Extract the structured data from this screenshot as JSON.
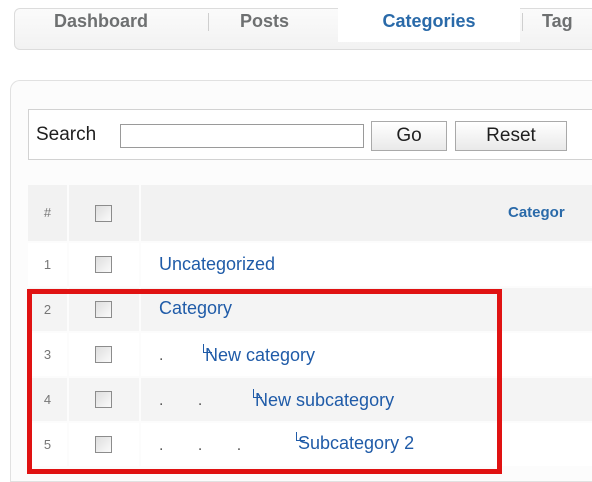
{
  "tabs": [
    {
      "label": "Dashboard",
      "active": false
    },
    {
      "label": "Posts",
      "active": false
    },
    {
      "label": "Categories",
      "active": true
    },
    {
      "label": "Tag",
      "active": false
    }
  ],
  "search": {
    "label": "Search",
    "value": "",
    "go_label": "Go",
    "reset_label": "Reset"
  },
  "table": {
    "header": {
      "num": "#",
      "name": "Categor"
    },
    "rows": [
      {
        "num": "1",
        "indent_dots": "",
        "name": "Uncategorized"
      },
      {
        "num": "2",
        "indent_dots": "",
        "name": "Category"
      },
      {
        "num": "3",
        "indent_dots": ".",
        "name": "New category"
      },
      {
        "num": "4",
        "indent_dots": ".       .",
        "name": "New subcategory"
      },
      {
        "num": "5",
        "indent_dots": ".       .       .",
        "name": "Subcategory 2"
      }
    ]
  },
  "colors": {
    "accent": "#2a6aa9",
    "link": "#1f5ba8",
    "highlight_border": "#e01212"
  }
}
